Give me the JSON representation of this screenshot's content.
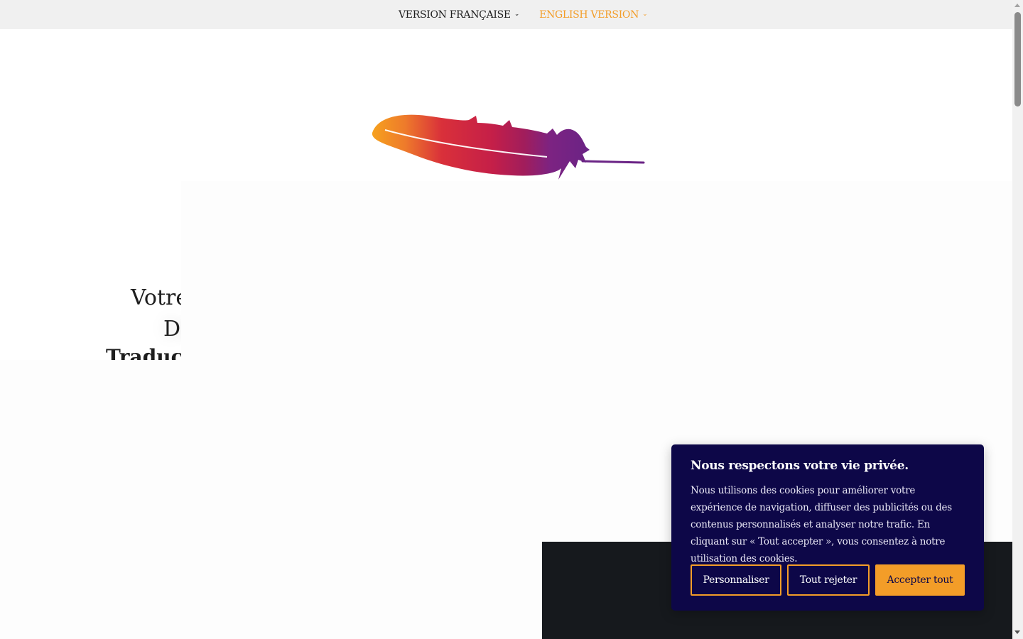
{
  "nav": {
    "items": [
      {
        "label": "VERSION FRANÇAISE",
        "active": false
      },
      {
        "label": "ENGLISH VERSION",
        "active": true
      }
    ],
    "active_color": "#f39d28"
  },
  "hero": {
    "logo_icon": "feather-icon",
    "title_line1": "Votre",
    "title_line2": "De",
    "title_line3": "Traducti"
  },
  "cookie_banner": {
    "title": "Nous respectons votre vie privée.",
    "text": "Nous utilisons des cookies pour améliorer votre expérience de navigation, diffuser des publicités ou des contenus personnalisés et analyser notre trafic. En cliquant sur « Tout accepter », vous consentez à notre utilisation des cookies.",
    "buttons": {
      "customize": "Personnaliser",
      "reject": "Tout rejeter",
      "accept": "Accepter tout"
    },
    "background_color": "#0d0748",
    "accent_color": "#f39d28"
  }
}
